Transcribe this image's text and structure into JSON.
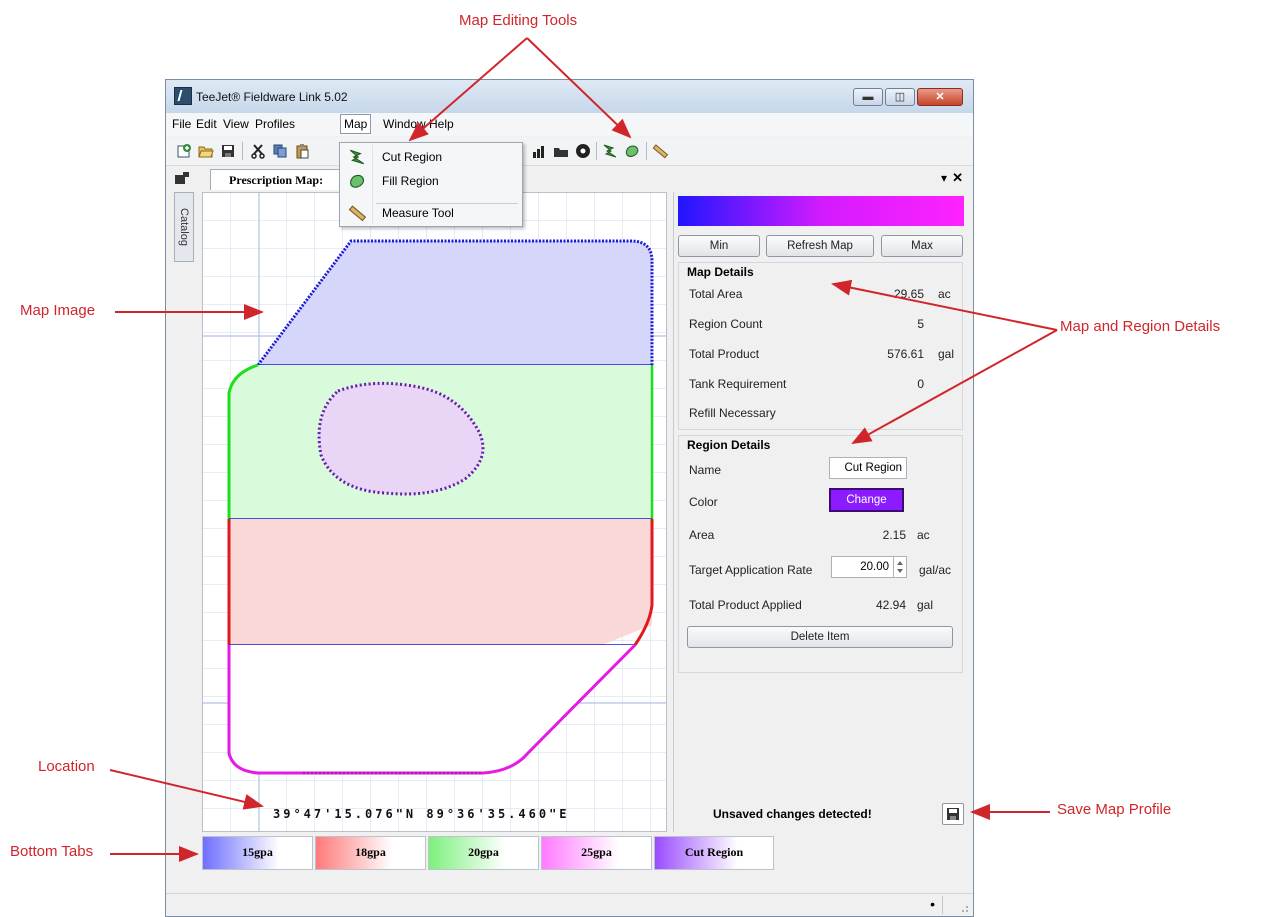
{
  "window": {
    "title": "TeeJet® Fieldware Link 5.02",
    "controls": [
      "minimize",
      "restore",
      "close"
    ]
  },
  "menubar": {
    "items": [
      "File",
      "Edit",
      "View",
      "Profiles",
      "Map",
      "Window",
      "Help"
    ],
    "open_menu": "Map"
  },
  "map_menu": {
    "items": [
      {
        "label": "Cut Region",
        "icon": "cut-region-icon"
      },
      {
        "label": "Fill Region",
        "icon": "fill-region-icon"
      },
      {
        "label": "Measure Tool",
        "icon": "measure-tool-icon"
      }
    ]
  },
  "toolbar": {
    "icons": [
      "new-icon",
      "open-folder-icon",
      "save-icon",
      "cut-icon",
      "copy-icon",
      "paste-icon",
      "chart-icon",
      "folder-icon",
      "record-icon",
      "cut-region-icon",
      "fill-region-icon",
      "measure-tool-icon"
    ]
  },
  "sidebar": {
    "catalog_tab": "Catalog"
  },
  "document_tab": {
    "label": "Prescription Map:",
    "close": "✕",
    "dropdown": "▾"
  },
  "map": {
    "location": "39°47'15.076\"N 89°36'35.460\"E",
    "zones": [
      {
        "name": "15gpa",
        "color": "#1a1ad6",
        "fill": "#d6d6fb"
      },
      {
        "name": "20gpa",
        "color": "#19e019",
        "fill": "#d9fadb"
      },
      {
        "name": "18gpa",
        "color": "#e01a1a",
        "fill": "#fbd8d8"
      },
      {
        "name": "25gpa",
        "color": "#e51ae5",
        "fill": "#ffffff"
      },
      {
        "name": "Cut Region",
        "color": "#7a1ad6",
        "fill": "#e9d6f7"
      }
    ]
  },
  "panel": {
    "buttons": {
      "min": "Min",
      "refresh": "Refresh Map",
      "max": "Max"
    },
    "map_details": {
      "title": "Map Details",
      "rows": [
        {
          "label": "Total Area",
          "value": "29.65",
          "unit": "ac"
        },
        {
          "label": "Region Count",
          "value": "5",
          "unit": ""
        },
        {
          "label": "Total Product",
          "value": "576.61",
          "unit": "gal"
        },
        {
          "label": "Tank Requirement",
          "value": "0",
          "unit": ""
        },
        {
          "label": "Refill Necessary",
          "value": "",
          "unit": ""
        }
      ]
    },
    "region_details": {
      "title": "Region Details",
      "name_label": "Name",
      "name_value": "Cut Region",
      "color_label": "Color",
      "color_button": "Change",
      "color_value": "#8b1cff",
      "area_label": "Area",
      "area_value": "2.15",
      "area_unit": "ac",
      "rate_label": "Target Application Rate",
      "rate_value": "20.00",
      "rate_unit": "gal/ac",
      "product_label": "Total Product Applied",
      "product_value": "42.94",
      "product_unit": "gal",
      "delete_button": "Delete Item"
    },
    "unsaved": "Unsaved changes detected!"
  },
  "bottom_tabs": [
    {
      "label": "15gpa",
      "color": "#6f6fff"
    },
    {
      "label": "18gpa",
      "color": "#ff7a7a"
    },
    {
      "label": "20gpa",
      "color": "#7df07d"
    },
    {
      "label": "25gpa",
      "color": "#ff7aff"
    },
    {
      "label": "Cut Region",
      "color": "#9a4cff"
    }
  ],
  "status_bar": {
    "indicator": "•"
  },
  "callouts": {
    "map_editing_tools": "Map Editing Tools",
    "map_image": "Map Image",
    "map_region_details": "Map and Region Details",
    "location": "Location",
    "save_map_profile": "Save Map Profile",
    "bottom_tabs": "Bottom Tabs"
  },
  "accent_color": "#d0262b"
}
